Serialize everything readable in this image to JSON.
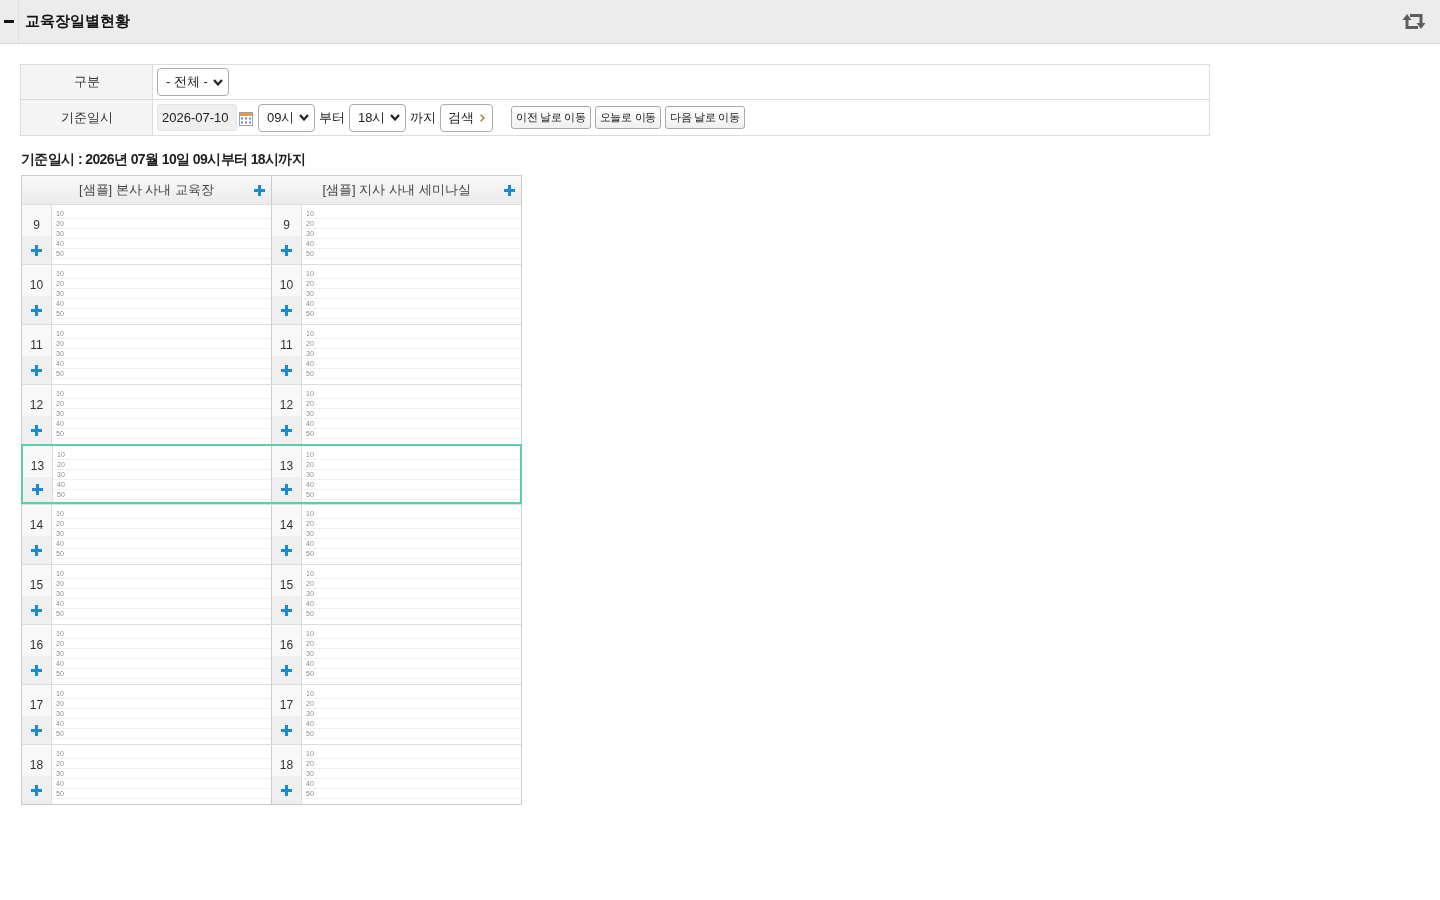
{
  "header": {
    "title": "교육장일별현황"
  },
  "filters": [
    {
      "kind": "category",
      "label": "구분",
      "value": "- 전체 -"
    },
    {
      "kind": "datetime",
      "label": "기준일시",
      "date": "2026-07-10",
      "start": "09시",
      "from_text": "부터",
      "end": "18시",
      "to_text": "까지",
      "search": "검색",
      "nav_buttons": [
        "이전 날로 이동",
        "오늘로 이동",
        "다음 날로 이동"
      ]
    }
  ],
  "summary": "기준일시 : 2026년 07월 10일 09시부터 18시까지",
  "schedule": {
    "rooms": [
      {
        "name": "[샘플] 본사 사내 교육장"
      },
      {
        "name": "[샘플] 지사 사내 세미나실"
      }
    ],
    "rows": [
      {
        "current": false,
        "cells": [
          {
            "hour": "9",
            "minute_marks": [
              "10",
              "20",
              "30",
              "40",
              "50"
            ]
          },
          {
            "hour": "9",
            "minute_marks": [
              "10",
              "20",
              "30",
              "40",
              "50"
            ]
          }
        ]
      },
      {
        "current": false,
        "cells": [
          {
            "hour": "10",
            "minute_marks": [
              "10",
              "20",
              "30",
              "40",
              "50"
            ]
          },
          {
            "hour": "10",
            "minute_marks": [
              "10",
              "20",
              "30",
              "40",
              "50"
            ]
          }
        ]
      },
      {
        "current": false,
        "cells": [
          {
            "hour": "11",
            "minute_marks": [
              "10",
              "20",
              "30",
              "40",
              "50"
            ]
          },
          {
            "hour": "11",
            "minute_marks": [
              "10",
              "20",
              "30",
              "40",
              "50"
            ]
          }
        ]
      },
      {
        "current": false,
        "cells": [
          {
            "hour": "12",
            "minute_marks": [
              "10",
              "20",
              "30",
              "40",
              "50"
            ]
          },
          {
            "hour": "12",
            "minute_marks": [
              "10",
              "20",
              "30",
              "40",
              "50"
            ]
          }
        ]
      },
      {
        "current": true,
        "cells": [
          {
            "hour": "13",
            "minute_marks": [
              "10",
              "20",
              "30",
              "40",
              "50"
            ]
          },
          {
            "hour": "13",
            "minute_marks": [
              "10",
              "20",
              "30",
              "40",
              "50"
            ]
          }
        ]
      },
      {
        "current": false,
        "cells": [
          {
            "hour": "14",
            "minute_marks": [
              "10",
              "20",
              "30",
              "40",
              "50"
            ]
          },
          {
            "hour": "14",
            "minute_marks": [
              "10",
              "20",
              "30",
              "40",
              "50"
            ]
          }
        ]
      },
      {
        "current": false,
        "cells": [
          {
            "hour": "15",
            "minute_marks": [
              "10",
              "20",
              "30",
              "40",
              "50"
            ]
          },
          {
            "hour": "15",
            "minute_marks": [
              "10",
              "20",
              "30",
              "40",
              "50"
            ]
          }
        ]
      },
      {
        "current": false,
        "cells": [
          {
            "hour": "16",
            "minute_marks": [
              "10",
              "20",
              "30",
              "40",
              "50"
            ]
          },
          {
            "hour": "16",
            "minute_marks": [
              "10",
              "20",
              "30",
              "40",
              "50"
            ]
          }
        ]
      },
      {
        "current": false,
        "cells": [
          {
            "hour": "17",
            "minute_marks": [
              "10",
              "20",
              "30",
              "40",
              "50"
            ]
          },
          {
            "hour": "17",
            "minute_marks": [
              "10",
              "20",
              "30",
              "40",
              "50"
            ]
          }
        ]
      },
      {
        "current": false,
        "cells": [
          {
            "hour": "18",
            "minute_marks": [
              "10",
              "20",
              "30",
              "40",
              "50"
            ]
          },
          {
            "hour": "18",
            "minute_marks": [
              "10",
              "20",
              "30",
              "40",
              "50"
            ]
          }
        ]
      }
    ]
  }
}
